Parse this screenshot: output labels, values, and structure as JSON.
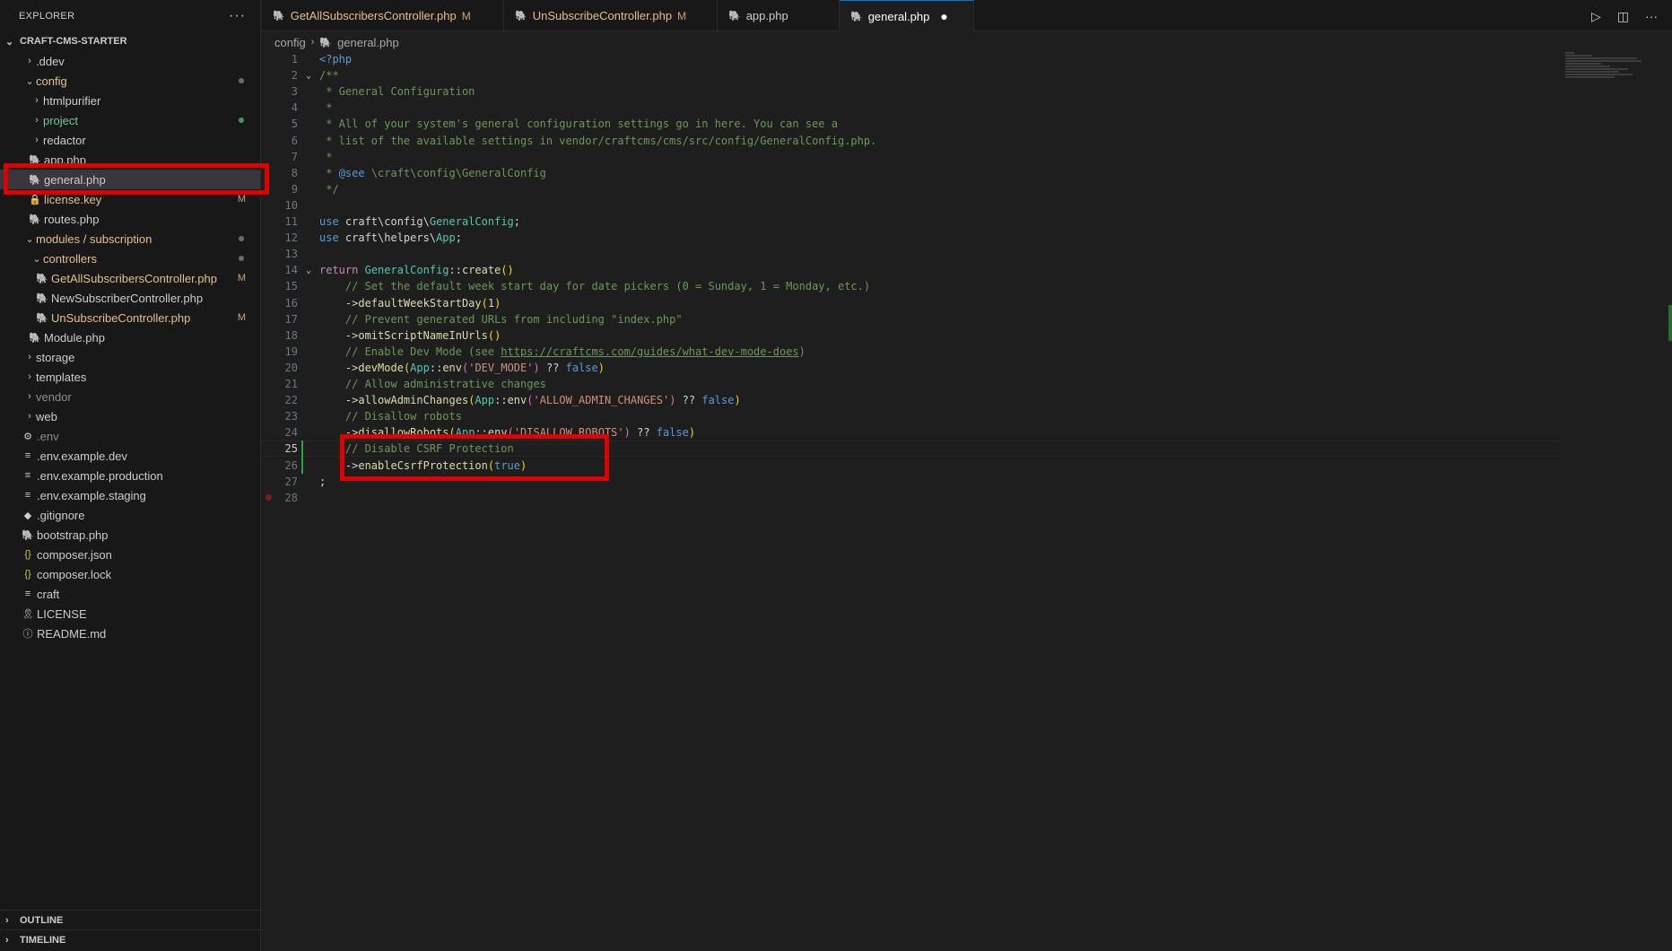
{
  "explorer": {
    "title": "EXPLORER",
    "more": "···",
    "project": "CRAFT-CMS-STARTER",
    "tree": [
      {
        "label": ".ddev",
        "type": "folder",
        "indent": 1,
        "open": false
      },
      {
        "label": "config",
        "type": "folder",
        "indent": 1,
        "open": true,
        "status": "modified",
        "dot": "gray"
      },
      {
        "label": "htmlpurifier",
        "type": "folder",
        "indent": 2,
        "open": false
      },
      {
        "label": "project",
        "type": "folder",
        "indent": 2,
        "open": false,
        "status": "untracked",
        "dot": "green"
      },
      {
        "label": "redactor",
        "type": "folder",
        "indent": 2,
        "open": false
      },
      {
        "label": "app.php",
        "type": "php",
        "indent": 2
      },
      {
        "label": "general.php",
        "type": "php",
        "indent": 2,
        "selected": true
      },
      {
        "label": "license.key",
        "type": "lock",
        "indent": 2,
        "status": "modified",
        "badge": "M"
      },
      {
        "label": "routes.php",
        "type": "php",
        "indent": 2
      },
      {
        "label": "modules / subscription",
        "type": "folder",
        "indent": 1,
        "open": true,
        "status": "modified",
        "dot": "gray"
      },
      {
        "label": "controllers",
        "type": "folder",
        "indent": 2,
        "open": true,
        "status": "modified",
        "dot": "gray"
      },
      {
        "label": "GetAllSubscribersController.php",
        "type": "php",
        "indent": 3,
        "status": "modified",
        "badge": "M"
      },
      {
        "label": "NewSubscriberController.php",
        "type": "php",
        "indent": 3
      },
      {
        "label": "UnSubscribeController.php",
        "type": "php",
        "indent": 3,
        "status": "modified",
        "badge": "M"
      },
      {
        "label": "Module.php",
        "type": "php",
        "indent": 2
      },
      {
        "label": "storage",
        "type": "folder",
        "indent": 1,
        "open": false
      },
      {
        "label": "templates",
        "type": "folder",
        "indent": 1,
        "open": false
      },
      {
        "label": "vendor",
        "type": "folder",
        "indent": 1,
        "open": false,
        "status": "ignored"
      },
      {
        "label": "web",
        "type": "folder",
        "indent": 1,
        "open": false
      },
      {
        "label": ".env",
        "type": "gear",
        "indent": 1,
        "status": "ignored"
      },
      {
        "label": ".env.example.dev",
        "type": "lines",
        "indent": 1
      },
      {
        "label": ".env.example.production",
        "type": "lines",
        "indent": 1
      },
      {
        "label": ".env.example.staging",
        "type": "lines",
        "indent": 1
      },
      {
        "label": ".gitignore",
        "type": "diamond",
        "indent": 1
      },
      {
        "label": "bootstrap.php",
        "type": "php",
        "indent": 1
      },
      {
        "label": "composer.json",
        "type": "json",
        "indent": 1
      },
      {
        "label": "composer.lock",
        "type": "json",
        "indent": 1
      },
      {
        "label": "craft",
        "type": "lines",
        "indent": 1
      },
      {
        "label": "LICENSE",
        "type": "person",
        "indent": 1
      },
      {
        "label": "README.md",
        "type": "info",
        "indent": 1
      }
    ],
    "outline": "OUTLINE",
    "timeline": "TIMELINE"
  },
  "tabs": [
    {
      "label": "GetAllSubscribersController.php",
      "badge": "M",
      "active": false
    },
    {
      "label": "UnSubscribeController.php",
      "badge": "M",
      "active": false
    },
    {
      "label": "app.php",
      "badge": "",
      "active": false
    },
    {
      "label": "general.php",
      "badge": "",
      "active": true,
      "dirty": true
    }
  ],
  "breadcrumb": {
    "folder": "config",
    "file": "general.php"
  },
  "editor": {
    "current_line": 25,
    "lines": [
      {
        "n": 1,
        "html": "<span class='k'>&lt;?php</span>"
      },
      {
        "n": 2,
        "fold": true,
        "html": "<span class='cm'>/**</span>"
      },
      {
        "n": 3,
        "html": "<span class='cm'> * General Configuration</span>"
      },
      {
        "n": 4,
        "html": "<span class='cm'> *</span>"
      },
      {
        "n": 5,
        "html": "<span class='cm'> * All of your system's general configuration settings go in here. You can see a</span>"
      },
      {
        "n": 6,
        "html": "<span class='cm'> * list of the available settings in vendor/craftcms/cms/src/config/GeneralConfig.php.</span>"
      },
      {
        "n": 7,
        "html": "<span class='cm'> *</span>"
      },
      {
        "n": 8,
        "html": "<span class='cm'> * </span><span class='doc-tag'>@see</span><span class='cm'> \\craft\\config\\GeneralConfig</span>"
      },
      {
        "n": 9,
        "html": "<span class='cm'> */</span>"
      },
      {
        "n": 10,
        "html": ""
      },
      {
        "n": 11,
        "html": "<span class='k'>use</span> craft\\config\\<span class='cls'>GeneralConfig</span>;"
      },
      {
        "n": 12,
        "html": "<span class='k'>use</span> craft\\helpers\\<span class='cls'>App</span>;"
      },
      {
        "n": 13,
        "html": ""
      },
      {
        "n": 14,
        "fold": true,
        "html": "<span class='kw'>return</span> <span class='cls'>GeneralConfig</span>::<span class='fn'>create</span><span class='paren'>()</span>"
      },
      {
        "n": 15,
        "html": "    <span class='cm'>// Set the default week start day for date pickers (0 = Sunday, 1 = Monday, etc.)</span>"
      },
      {
        "n": 16,
        "html": "    -&gt;<span class='fn'>defaultWeekStartDay</span><span class='paren'>(</span>1<span class='paren'>)</span>"
      },
      {
        "n": 17,
        "html": "    <span class='cm'>// Prevent generated URLs from including \"index.php\"</span>"
      },
      {
        "n": 18,
        "html": "    -&gt;<span class='fn'>omitScriptNameInUrls</span><span class='paren'>()</span>"
      },
      {
        "n": 19,
        "html": "    <span class='cm'>// Enable Dev Mode (see </span><span class='cm-link'>https://craftcms.com/guides/what-dev-mode-does</span><span class='cm'>)</span>"
      },
      {
        "n": 20,
        "html": "    -&gt;<span class='fn'>devMode</span><span class='paren'>(</span><span class='cls'>App</span>::<span class='fn'>env</span><span class='paren2'>(</span><span class='str'>'DEV_MODE'</span><span class='paren2'>)</span> ?? <span class='k'>false</span><span class='paren'>)</span>"
      },
      {
        "n": 21,
        "html": "    <span class='cm'>// Allow administrative changes</span>"
      },
      {
        "n": 22,
        "html": "    -&gt;<span class='fn'>allowAdminChanges</span><span class='paren'>(</span><span class='cls'>App</span>::<span class='fn'>env</span><span class='paren2'>(</span><span class='str'>'ALLOW_ADMIN_CHANGES'</span><span class='paren2'>)</span> ?? <span class='k'>false</span><span class='paren'>)</span>"
      },
      {
        "n": 23,
        "html": "    <span class='cm'>// Disallow robots</span>"
      },
      {
        "n": 24,
        "html": "    -&gt;<span class='fn'>disallowRobots</span><span class='paren'>(</span><span class='cls'>App</span>::<span class='fn'>env</span><span class='paren2'>(</span><span class='str'>'DISALLOW_ROBOTS'</span><span class='paren2'>)</span> ?? <span class='k'>false</span><span class='paren'>)</span>"
      },
      {
        "n": 25,
        "html": "    <span class='cm'>// Disable CSRF Protection</span>"
      },
      {
        "n": 26,
        "html": "    -&gt;<span class='fn'>enableCsrfProtection</span><span class='paren'>(</span><span class='k'>true</span><span class='paren'>)</span>"
      },
      {
        "n": 27,
        "html": ";"
      },
      {
        "n": 28,
        "html": ""
      }
    ]
  },
  "colors": {
    "highlight_box": "#e00000",
    "accent": "#0078d4",
    "modified": "#e2c08d",
    "untracked": "#73c991"
  }
}
